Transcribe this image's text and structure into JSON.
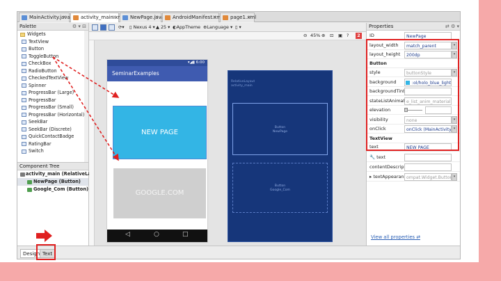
{
  "tabs": [
    {
      "label": "MainActivity.java"
    },
    {
      "label": "activity_main.xml"
    },
    {
      "label": "NewPage.java"
    },
    {
      "label": "AndroidManifest.xml"
    },
    {
      "label": "page1.xml"
    }
  ],
  "palette": {
    "title": "Palette",
    "items": [
      {
        "label": "Widgets"
      },
      {
        "label": "TextView"
      },
      {
        "label": "Button"
      },
      {
        "label": "ToggleButton"
      },
      {
        "label": "CheckBox"
      },
      {
        "label": "RadioButton"
      },
      {
        "label": "CheckedTextView"
      },
      {
        "label": "Spinner"
      },
      {
        "label": "ProgressBar (Large)"
      },
      {
        "label": "ProgressBar"
      },
      {
        "label": "ProgressBar (Small)"
      },
      {
        "label": "ProgressBar (Horizontal)"
      },
      {
        "label": "SeekBar"
      },
      {
        "label": "SeekBar (Discrete)"
      },
      {
        "label": "QuickContactBadge"
      },
      {
        "label": "RatingBar"
      },
      {
        "label": "Switch"
      }
    ]
  },
  "component_tree": {
    "title": "Component Tree",
    "root": "activity_main (RelativeLayo",
    "child1": "NewPage (Button)",
    "child2": "Google_Com (Button)"
  },
  "toolbar": {
    "device": "Nexus 4",
    "api": "25",
    "theme": "AppTheme",
    "language": "Language",
    "zoom": "45%",
    "error_count": "2"
  },
  "preview": {
    "time": "6:00",
    "app_title": "SeminarExamples",
    "button1": "NEW PAGE",
    "button2": "GOOGLE.COM",
    "nav_back": "◁",
    "nav_home": "○",
    "nav_recent": "□"
  },
  "blueprint": {
    "layout_label": "RelativeLayout\nactivity_main",
    "button1_label": "Button\nNewPage",
    "button2_label": "Button\nGoogle_Com"
  },
  "properties": {
    "title": "Properties",
    "id_label": "ID",
    "id_value": "NewPage",
    "layout_width_label": "layout_width",
    "layout_width_value": "match_parent",
    "layout_height_label": "layout_height",
    "layout_height_value": "200dp",
    "button_section": "Button",
    "style_label": "style",
    "style_value": "buttonStyle",
    "background_label": "background",
    "background_value": ":ol/holo_blue_light",
    "background_tint_label": "backgroundTint",
    "state_list_label": "stateListAnimator",
    "state_list_value": "e_list_anim_material",
    "elevation_label": "elevation",
    "visibility_label": "visibility",
    "visibility_value": "none",
    "onclick_label": "onClick",
    "onclick_value": "onClick (MainActivity)",
    "textview_section": "TextView",
    "text_label": "text",
    "text_value": "NEW PAGE",
    "text2_label": "text",
    "content_desc_label": "contentDescripti...",
    "text_appearance_label": "textAppearan...",
    "text_appearance_value": "ompat.Widget.Button",
    "view_all": "View all properties"
  },
  "mode_tabs": {
    "design": "Design",
    "text": "Text"
  },
  "colors": {
    "highlight_red": "#e02020",
    "button_blue": "#33b5e5",
    "blueprint_navy": "#16367a",
    "band_pink": "#f6a9a9"
  }
}
